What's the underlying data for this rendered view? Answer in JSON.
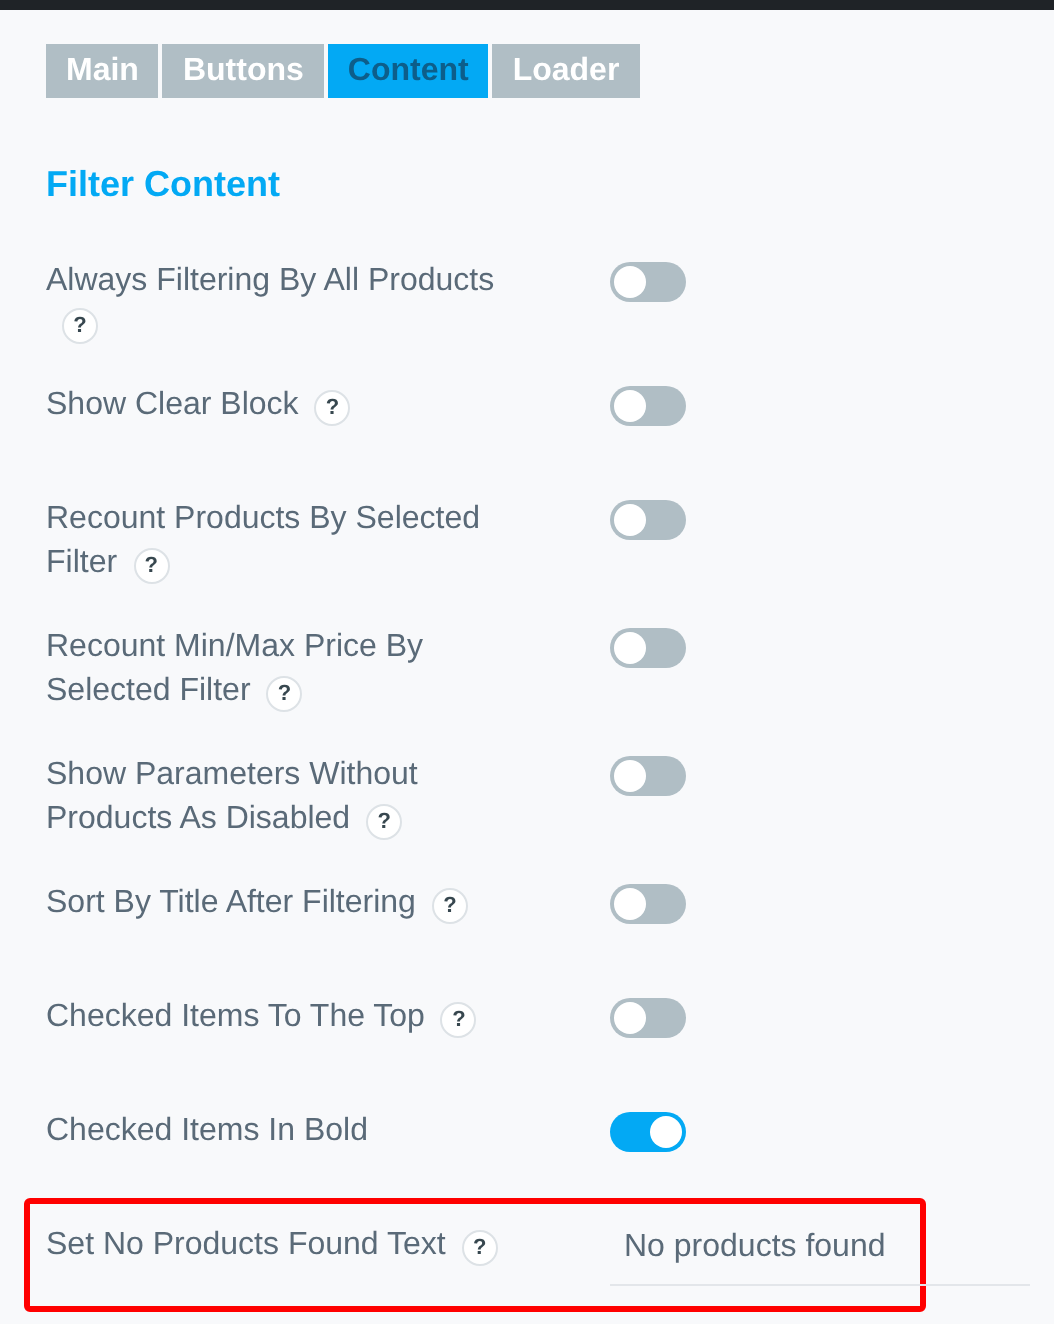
{
  "tabs": [
    {
      "label": "Main",
      "selected": false
    },
    {
      "label": "Buttons",
      "selected": false
    },
    {
      "label": "Content",
      "selected": true
    },
    {
      "label": "Loader",
      "selected": false
    }
  ],
  "section_title": "Filter Content",
  "settings": [
    {
      "kind": "toggle",
      "label_lines": [
        "Always Filtering By All Products"
      ],
      "help": "?",
      "on": false,
      "highlighted": false
    },
    {
      "kind": "toggle",
      "label_lines": [
        "Show Clear Block"
      ],
      "help": "?",
      "on": false,
      "highlighted": false
    },
    {
      "kind": "toggle",
      "label_lines": [
        "Recount Products By Selected",
        "Filter"
      ],
      "help": "?",
      "on": false,
      "highlighted": false
    },
    {
      "kind": "toggle",
      "label_lines": [
        "Recount Min/Max Price By",
        "Selected Filter"
      ],
      "help": "?",
      "on": false,
      "highlighted": false
    },
    {
      "kind": "toggle",
      "label_lines": [
        "Show Parameters Without",
        "Products As Disabled"
      ],
      "help": "?",
      "on": false,
      "highlighted": false
    },
    {
      "kind": "toggle",
      "label_lines": [
        "Sort By Title After Filtering"
      ],
      "help": "?",
      "on": false,
      "highlighted": false
    },
    {
      "kind": "toggle",
      "label_lines": [
        "Checked Items To The Top"
      ],
      "help": "?",
      "on": false,
      "highlighted": false
    },
    {
      "kind": "toggle",
      "label_lines": [
        "Checked Items In Bold"
      ],
      "on": true,
      "highlighted": false
    },
    {
      "kind": "text",
      "label_lines": [
        "Set No Products Found Text"
      ],
      "help": "?",
      "value": "No products found",
      "highlighted": true
    }
  ]
}
